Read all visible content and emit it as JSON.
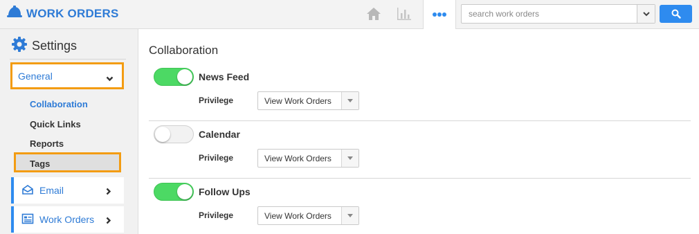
{
  "app": {
    "title": "WORK ORDERS"
  },
  "search": {
    "placeholder": "search work orders"
  },
  "sidebar": {
    "settings_title": "Settings",
    "general_label": "General",
    "subnav": [
      "Collaboration",
      "Quick Links",
      "Reports",
      "Tags"
    ],
    "items": [
      {
        "label": "Email"
      },
      {
        "label": "Work Orders"
      }
    ]
  },
  "main": {
    "title": "Collaboration",
    "sections": [
      {
        "label": "News Feed",
        "enabled": true,
        "privilege_label": "Privilege",
        "privilege_value": "View Work Orders"
      },
      {
        "label": "Calendar",
        "enabled": false,
        "privilege_label": "Privilege",
        "privilege_value": "View Work Orders"
      },
      {
        "label": "Follow Ups",
        "enabled": true,
        "privilege_label": "Privilege",
        "privilege_value": "View Work Orders"
      }
    ]
  },
  "colors": {
    "accent": "#2e7bd6",
    "highlight": "#f39c12",
    "toggle_on": "#4cd964"
  }
}
